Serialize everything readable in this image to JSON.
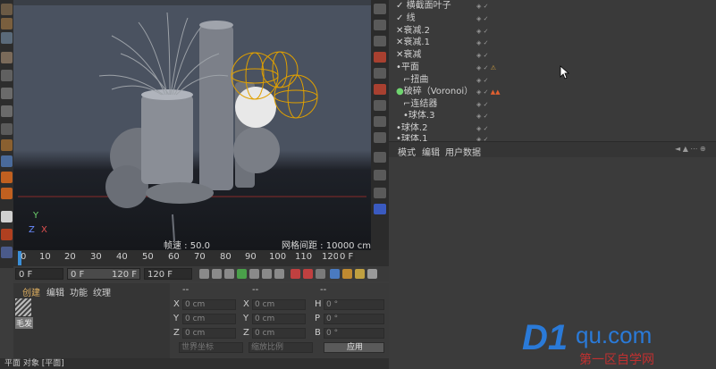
{
  "viewport": {
    "fps_label": "帧速 : 50.0",
    "grid_label": "网格间距 : 10000 cm",
    "axis_y": "Y",
    "axis_z": "Z",
    "axis_x": "X"
  },
  "objects": [
    {
      "name": "横截面叶子",
      "prefix": "✓"
    },
    {
      "name": "线",
      "prefix": "✓"
    },
    {
      "name": "衰减.2",
      "prefix": "✕"
    },
    {
      "name": "衰减.1",
      "prefix": "✕"
    },
    {
      "name": "衰减",
      "prefix": "✕"
    },
    {
      "name": "平面",
      "prefix": "•"
    },
    {
      "name": "扭曲",
      "prefix": "⌐"
    },
    {
      "name": "破碎（Voronoi）",
      "prefix": "●"
    },
    {
      "name": "连结器",
      "prefix": "⌐"
    },
    {
      "name": "球体.3",
      "prefix": "•"
    },
    {
      "name": "球体.2",
      "prefix": "•"
    },
    {
      "name": "球体.1",
      "prefix": "•"
    }
  ],
  "attributes": {
    "menu": [
      "模式",
      "编辑",
      "用户数据"
    ]
  },
  "timeline": {
    "ticks": [
      "0",
      "10",
      "20",
      "30",
      "40",
      "50",
      "60",
      "70",
      "80",
      "90",
      "100",
      "110",
      "120"
    ],
    "current_frame": "0 F"
  },
  "transport": {
    "start_field": "0 F",
    "range_start": "0 F",
    "range_end": "120 F",
    "end_field": "120 F"
  },
  "materials": {
    "menu": [
      "创建",
      "编辑",
      "功能",
      "纹理"
    ],
    "swatch_label": "毛发"
  },
  "coords": {
    "col_headers": [
      "--",
      "--",
      "--"
    ],
    "rows": [
      {
        "a_lbl": "X",
        "a_val": "0 cm",
        "b_lbl": "X",
        "b_val": "0 cm",
        "c_lbl": "H",
        "c_val": "0 °"
      },
      {
        "a_lbl": "Y",
        "a_val": "0 cm",
        "b_lbl": "Y",
        "b_val": "0 cm",
        "c_lbl": "P",
        "c_val": "0 °"
      },
      {
        "a_lbl": "Z",
        "a_val": "0 cm",
        "b_lbl": "Z",
        "b_val": "0 cm",
        "c_lbl": "B",
        "c_val": "0 °"
      }
    ],
    "world_coords": "世界坐标",
    "scale": "缩放比例",
    "apply": "应用"
  },
  "status": {
    "text": "平面 对象 [平面]"
  },
  "watermark": {
    "brand_d1": "D1",
    "brand_qu": "qu.com",
    "tagline": "第一区自学网"
  }
}
